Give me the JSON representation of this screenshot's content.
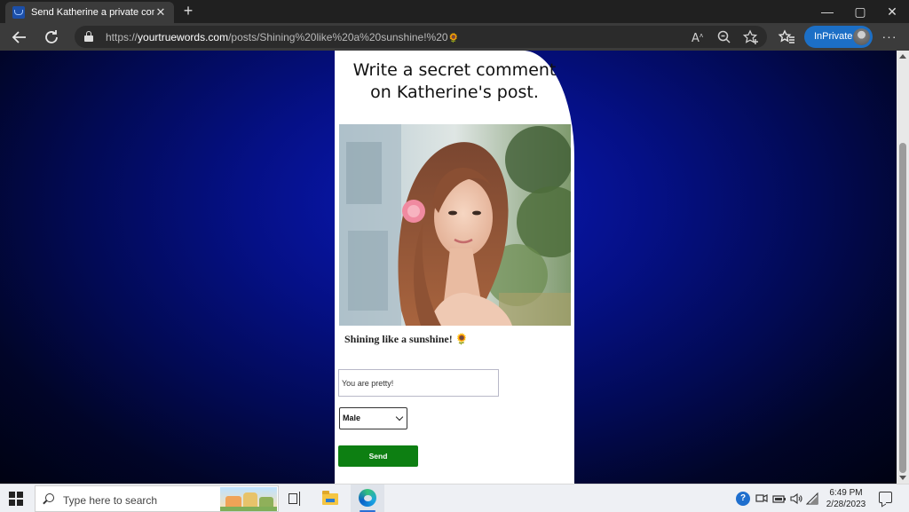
{
  "browser": {
    "tab_title": "Send Katherine a private comme",
    "tab_close": "✕",
    "new_tab": "+",
    "window_controls": {
      "minimize": "—",
      "maximize": "▢",
      "close": "✕"
    },
    "url_scheme": "https://",
    "url_domain": "yourtruewords.com",
    "url_path": "/posts/Shining%20like%20a%20sunshine!%20",
    "url_emoji": "🌻",
    "inprivate_label": "InPrivate",
    "more_label": "···",
    "icons": [
      "back-arrow-icon",
      "refresh-icon",
      "lock-icon",
      "read-aloud-icon",
      "zoom-icon",
      "favorite-add-icon",
      "favorites-icon",
      "profile-icon",
      "more-icon"
    ]
  },
  "page": {
    "heading": "Write a secret comment on Katherine's post.",
    "post_caption": "Shining like a sunshine! 🌻",
    "comment_input_value": "You are pretty!",
    "gender_select_value": "Male",
    "send_button_label": "Send",
    "background_color": "#0a19b8",
    "send_button_color": "#0d7f12"
  },
  "taskbar": {
    "search_placeholder": "Type here to search",
    "time": "6:49 PM",
    "date": "2/28/2023",
    "help_badge": "?",
    "tray_icons": [
      "help-icon",
      "meet-now-icon",
      "battery-icon",
      "volume-icon",
      "wifi-icon",
      "notification-icon"
    ]
  }
}
